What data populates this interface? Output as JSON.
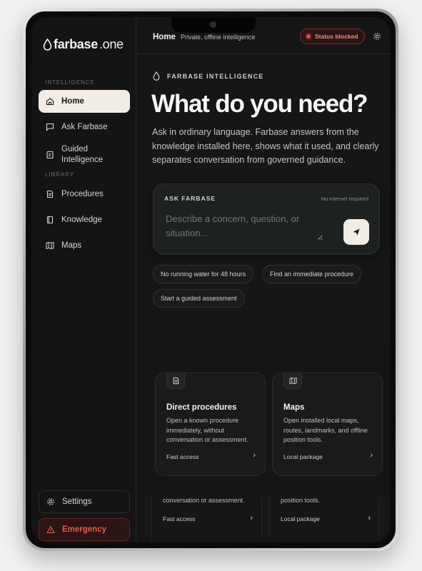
{
  "brand": {
    "name_bold": "farbase",
    "name_light": ".one"
  },
  "sidebar": {
    "section_intelligence": "INTELLIGENCE",
    "section_library": "LIBRARY",
    "items": [
      {
        "label": "Home",
        "icon": "home-icon",
        "active": true
      },
      {
        "label": "Ask Farbase",
        "icon": "chat-icon"
      },
      {
        "label": "Guided Intelligence",
        "icon": "guide-icon"
      },
      {
        "label": "Procedures",
        "icon": "document-icon"
      },
      {
        "label": "Knowledge",
        "icon": "book-icon"
      },
      {
        "label": "Maps",
        "icon": "map-icon"
      }
    ],
    "settings_label": "Settings",
    "emergency_label": "Emergency"
  },
  "topbar": {
    "home_label": "Home",
    "subtitle": "Private, offline intelligence",
    "status_label": "Status blocked"
  },
  "hero": {
    "eyebrow": "FARBASE INTELLIGENCE",
    "headline": "What do you need?",
    "intro": "Ask in ordinary language. Farbase answers from the knowledge installed here, shows what it used, and clearly separates conversation from governed guidance."
  },
  "ask": {
    "label": "ASK FARBASE",
    "note": "No internet required",
    "placeholder": "Describe a concern, question, or situation..."
  },
  "suggestions": [
    "No running water for 48 hours",
    "Find an immediate procedure",
    "Start a guided assessment"
  ],
  "cards": [
    {
      "title": "Direct procedures",
      "description": "Open a known procedure immediately, without conversation or assessment.",
      "footer": "Fast access",
      "icon": "document-icon"
    },
    {
      "title": "Maps",
      "description": "Open installed local maps, routes, landmarks, and offline position tools.",
      "footer": "Local package",
      "icon": "map-icon"
    }
  ],
  "cards_behind": [
    {
      "text": "conversation or assessment.",
      "footer": "Fast access"
    },
    {
      "text": "position tools.",
      "footer": "Local package"
    }
  ],
  "colors": {
    "background": "#161616",
    "accent_cream": "#f1ede4",
    "danger": "#e04a3e"
  }
}
